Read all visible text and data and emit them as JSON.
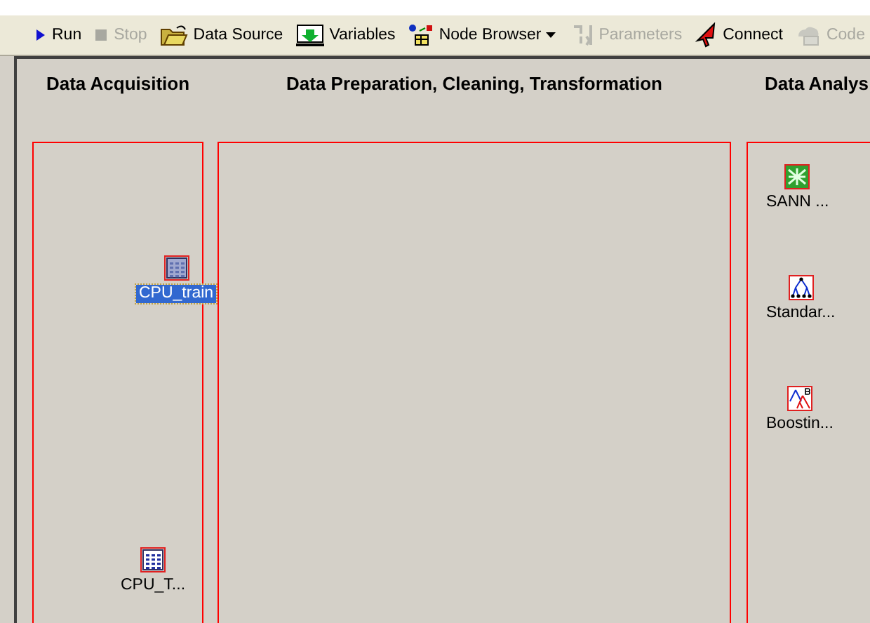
{
  "toolbar": [
    {
      "kind": "run",
      "label": "Run",
      "disabled": false
    },
    {
      "kind": "stop",
      "label": "Stop",
      "disabled": true
    },
    {
      "kind": "datasource",
      "label": "Data Source",
      "disabled": false
    },
    {
      "kind": "variables",
      "label": "Variables",
      "disabled": false
    },
    {
      "kind": "nodebrowser",
      "label": "Node Browser",
      "disabled": false,
      "dropdown": true
    },
    {
      "kind": "parameters",
      "label": "Parameters",
      "disabled": true
    },
    {
      "kind": "connect",
      "label": "Connect",
      "disabled": false
    },
    {
      "kind": "code",
      "label": "Code",
      "disabled": true
    }
  ],
  "workspace": {
    "columns": [
      {
        "title": "Data Acquisition",
        "nodes": [
          {
            "kind": "data",
            "label": "CPU_train",
            "selected": true
          },
          {
            "kind": "data",
            "label": "CPU_T...",
            "selected": false
          }
        ]
      },
      {
        "title": "Data Preparation, Cleaning, Transformation"
      },
      {
        "title": "Data Analys",
        "nodes": [
          {
            "kind": "neural",
            "label": "SANN ...",
            "selected": false
          },
          {
            "kind": "tree",
            "label": "Standar...",
            "selected": false
          },
          {
            "kind": "boosting",
            "label": "Boostin...",
            "selected": false
          }
        ]
      }
    ]
  }
}
